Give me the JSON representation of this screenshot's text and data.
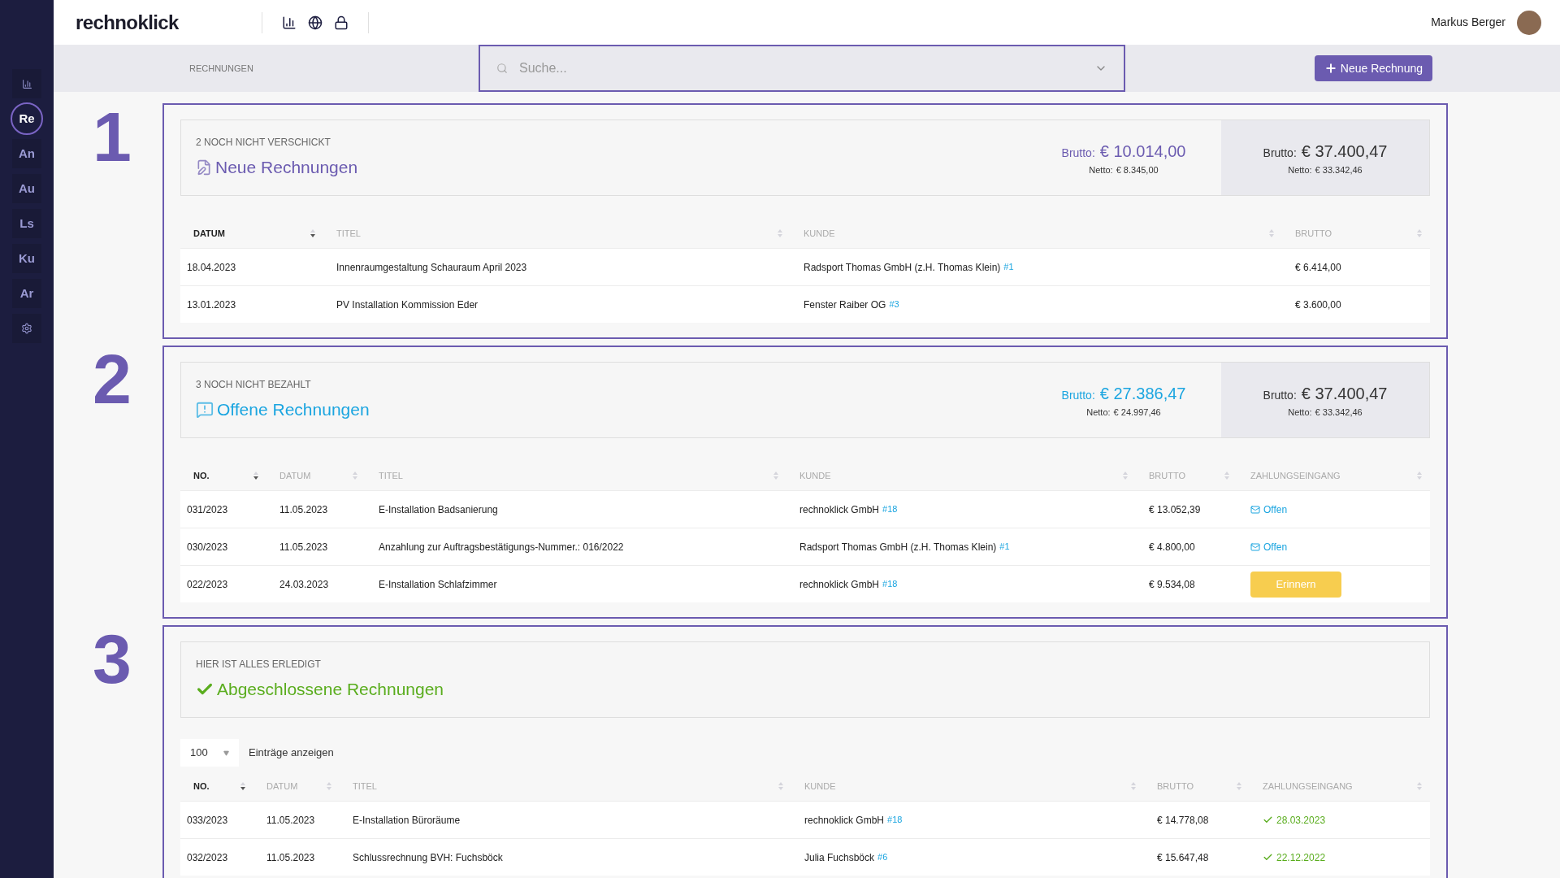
{
  "sidebar": {
    "items": [
      {
        "label": "Re",
        "selected": true
      },
      {
        "label": "An",
        "selected": false
      },
      {
        "label": "Au",
        "selected": false
      },
      {
        "label": "Ls",
        "selected": false
      },
      {
        "label": "Ku",
        "selected": false
      },
      {
        "label": "Ar",
        "selected": false
      }
    ]
  },
  "header": {
    "logo": "rechnoklick",
    "user": "Markus Berger"
  },
  "toolbar": {
    "breadcrumb": "RECHNUNGEN",
    "search": {
      "placeholder": "Suche..."
    },
    "new_button": "Neue Rechnung"
  },
  "sections": [
    {
      "number": "1",
      "subtitle": "2 NOCH NICHT VERSCHICKT",
      "title": "Neue Rechnungen",
      "kind": "new",
      "color": "#6b5bb0",
      "summary": {
        "brutto_label": "Brutto:",
        "brutto": "€ 10.014,00",
        "netto_label": "Netto:",
        "netto": "€ 8.345,00",
        "total_brutto_label": "Brutto:",
        "total_brutto": "€ 37.400,47",
        "total_netto_label": "Netto:",
        "total_netto": "€ 33.342,46"
      },
      "columns": [
        {
          "label": "DATUM",
          "sorted": true
        },
        {
          "label": "TITEL",
          "sorted": false
        },
        {
          "label": "KUNDE",
          "sorted": false
        },
        {
          "label": "BRUTTO",
          "sorted": false
        }
      ],
      "rows": [
        {
          "cells": [
            "18.04.2023",
            "Innenraumgestaltung Schauraum April 2023"
          ],
          "customer": "Radsport Thomas GmbH (z.H. Thomas Klein)",
          "customer_ref": "#1",
          "brutto": "€ 6.414,00"
        },
        {
          "cells": [
            "13.01.2023",
            "PV Installation Kommission Eder"
          ],
          "customer": "Fenster Raiber OG",
          "customer_ref": "#3",
          "brutto": "€ 3.600,00"
        }
      ]
    },
    {
      "number": "2",
      "subtitle": "3 NOCH NICHT BEZAHLT",
      "title": "Offene Rechnungen",
      "kind": "open",
      "color": "#1ba5e0",
      "summary": {
        "brutto_label": "Brutto:",
        "brutto": "€ 27.386,47",
        "netto_label": "Netto:",
        "netto": "€ 24.997,46",
        "total_brutto_label": "Brutto:",
        "total_brutto": "€ 37.400,47",
        "total_netto_label": "Netto:",
        "total_netto": "€ 33.342,46"
      },
      "columns": [
        {
          "label": "NO.",
          "sorted": true
        },
        {
          "label": "DATUM",
          "sorted": false
        },
        {
          "label": "TITEL",
          "sorted": false
        },
        {
          "label": "KUNDE",
          "sorted": false
        },
        {
          "label": "BRUTTO",
          "sorted": false
        },
        {
          "label": "ZAHLUNGSEINGANG",
          "sorted": false
        }
      ],
      "rows": [
        {
          "cells": [
            "031/2023",
            "11.05.2023",
            "E-Installation Badsanierung"
          ],
          "customer": "rechnoklick GmbH",
          "customer_ref": "#18",
          "brutto": "€ 13.052,39",
          "payment": {
            "kind": "open",
            "text": "Offen"
          }
        },
        {
          "cells": [
            "030/2023",
            "11.05.2023",
            "Anzahlung zur Auftragsbestätigungs-Nummer.: 016/2022"
          ],
          "customer": "Radsport Thomas GmbH (z.H. Thomas Klein)",
          "customer_ref": "#1",
          "brutto": "€ 4.800,00",
          "payment": {
            "kind": "open",
            "text": "Offen"
          }
        },
        {
          "cells": [
            "022/2023",
            "24.03.2023",
            "E-Installation Schlafzimmer"
          ],
          "customer": "rechnoklick GmbH",
          "customer_ref": "#18",
          "brutto": "€ 9.534,08",
          "payment": {
            "kind": "remind",
            "text": "Erinnern"
          }
        }
      ]
    },
    {
      "number": "3",
      "subtitle": "HIER IST ALLES ERLEDIGT",
      "title": "Abgeschlossene Rechnungen",
      "kind": "done",
      "color": "#5aad1e",
      "page_size": {
        "value": "100",
        "label": "Einträge anzeigen"
      },
      "columns": [
        {
          "label": "NO.",
          "sorted": true
        },
        {
          "label": "DATUM",
          "sorted": false
        },
        {
          "label": "TITEL",
          "sorted": false
        },
        {
          "label": "KUNDE",
          "sorted": false
        },
        {
          "label": "BRUTTO",
          "sorted": false
        },
        {
          "label": "ZAHLUNGSEINGANG",
          "sorted": false
        }
      ],
      "rows": [
        {
          "cells": [
            "033/2023",
            "11.05.2023",
            "E-Installation Büroräume"
          ],
          "customer": "rechnoklick GmbH",
          "customer_ref": "#18",
          "brutto": "€ 14.778,08",
          "payment": {
            "kind": "paid",
            "text": "28.03.2023"
          }
        },
        {
          "cells": [
            "032/2023",
            "11.05.2023",
            "Schlussrechnung BVH: Fuchsböck"
          ],
          "customer": "Julia Fuchsböck",
          "customer_ref": "#6",
          "brutto": "€ 15.647,48",
          "payment": {
            "kind": "paid",
            "text": "22.12.2022"
          }
        }
      ]
    }
  ]
}
